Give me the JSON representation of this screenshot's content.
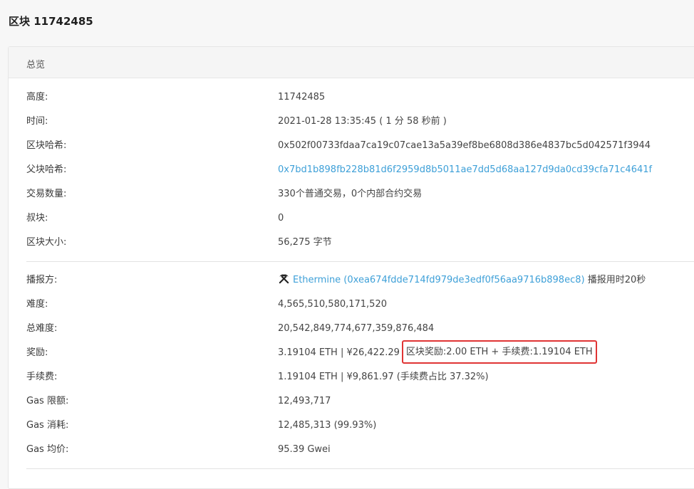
{
  "page": {
    "title": "区块 11742485"
  },
  "overview": {
    "title": "总览",
    "rows": [
      {
        "label": "高度:",
        "value": "11742485"
      },
      {
        "label": "时间:",
        "value": "2021-01-28 13:35:45 ( 1 分 58 秒前 )"
      },
      {
        "label": "区块哈希:",
        "value": "0x502f00733fdaa7ca19c07cae13a5a39ef8be6808d386e4837bc5d042571f3944"
      },
      {
        "label": "父块哈希:",
        "value": "0x7bd1b898fb228b81d6f2959d8b5011ae7dd5d68aa127d9da0cd39cfa71c4641f"
      },
      {
        "label": "交易数量:",
        "value": "330个普通交易，0个内部合约交易"
      },
      {
        "label": "叔块:",
        "value": "0"
      },
      {
        "label": "区块大小:",
        "value": "56,275 字节"
      }
    ],
    "miner": {
      "label": "播报方:",
      "icon": "pickaxe-icon",
      "link": "Ethermine (0xea674fdde714fd979de3edf0f56aa9716b898ec8)",
      "suffix": " 播报用时20秒"
    },
    "difficulty": {
      "label": "难度:",
      "value": "4,565,510,580,171,520"
    },
    "total_difficulty": {
      "label": "总难度:",
      "value": "20,542,849,774,677,359,876,484"
    },
    "reward": {
      "label": "奖励:",
      "value": "3.19104 ETH | ¥26,422.29",
      "breakdown": "区块奖励:2.00 ETH + 手续费:1.19104 ETH",
      "highlight_color": "#e03434"
    },
    "fee": {
      "label": "手续费:",
      "value": "1.19104 ETH | ¥9,861.97 (手续费占比 37.32%)"
    },
    "gas_limit": {
      "label": "Gas 限额:",
      "value": "12,493,717"
    },
    "gas_used": {
      "label": "Gas 消耗:",
      "value": "12,485,313 (99.93%)"
    },
    "gas_price": {
      "label": "Gas 均价:",
      "value": "95.39 Gwei"
    }
  },
  "colors": {
    "link": "#3ea0d8",
    "highlight": "#e03434"
  }
}
